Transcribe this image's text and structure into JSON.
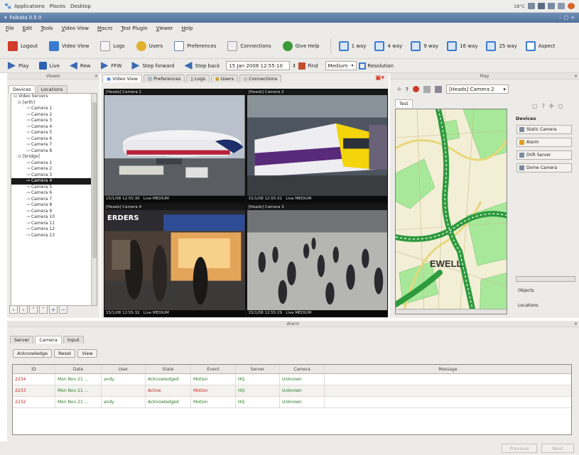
{
  "desktop": {
    "menu": [
      "Applications",
      "Places",
      "Desktop"
    ],
    "clock": "18°C"
  },
  "window": {
    "title": "Falkata 0.5.0",
    "controls": [
      "–",
      "□",
      "×"
    ]
  },
  "menubar": [
    "File",
    "Edit",
    "Tools",
    "Video View",
    "Macro",
    "Test Plugin",
    "Viewer",
    "Help"
  ],
  "toolbar1": [
    {
      "label": "Logout",
      "icon": "logout-icon",
      "color": "#d23a2a"
    },
    {
      "label": "Video View",
      "icon": "video-view-icon",
      "color": "#3b7bd0"
    },
    {
      "label": "Logs",
      "icon": "logs-icon",
      "color": "#e8e8e8"
    },
    {
      "label": "Users",
      "icon": "users-icon",
      "color": "#e0b030"
    },
    {
      "label": "Preferences",
      "icon": "preferences-icon",
      "color": "#8aa0c8"
    },
    {
      "label": "Connections",
      "icon": "connections-icon",
      "color": "#d8d8d8"
    },
    {
      "label": "Give Help",
      "icon": "help-icon",
      "color": "#3a9a3a"
    }
  ],
  "layout_buttons": [
    {
      "label": "1 way",
      "icon": "one-way-layout-icon"
    },
    {
      "label": "4 way",
      "icon": "four-way-layout-icon"
    },
    {
      "label": "9 way",
      "icon": "nine-way-layout-icon"
    },
    {
      "label": "16 way",
      "icon": "sixteen-way-layout-icon"
    },
    {
      "label": "25 way",
      "icon": "twenty-five-way-layout-icon"
    },
    {
      "label": "Aspect",
      "icon": "aspect-icon"
    }
  ],
  "toolbar2": {
    "buttons": [
      {
        "label": "Play",
        "icon": "play-icon"
      },
      {
        "label": "Live",
        "icon": "live-icon"
      },
      {
        "label": "Rew",
        "icon": "rewind-icon"
      },
      {
        "label": "FFW",
        "icon": "fast-forward-icon"
      },
      {
        "label": "Step forward",
        "icon": "step-forward-icon"
      },
      {
        "label": "Step back",
        "icon": "step-back-icon"
      }
    ],
    "datetime_value": "15 Jan 2008 12:55:10",
    "find_label": "Find",
    "resolution_value": "Medium",
    "resolution_label": "Resolution"
  },
  "viewer": {
    "header": "Viewer",
    "tabs": [
      "Devices",
      "Locations"
    ],
    "tree": [
      {
        "label": "Video Servers",
        "indent": 0,
        "icon": "folder-icon",
        "selected": false
      },
      {
        "label": "[erth]",
        "indent": 1,
        "icon": "server-icon",
        "selected": false
      },
      {
        "label": "Camera 1",
        "indent": 3,
        "icon": "camera-icon",
        "selected": false
      },
      {
        "label": "Camera 2",
        "indent": 3,
        "icon": "camera-icon",
        "selected": false
      },
      {
        "label": "Camera 3",
        "indent": 3,
        "icon": "camera-icon",
        "selected": false
      },
      {
        "label": "Camera 4",
        "indent": 3,
        "icon": "camera-icon",
        "selected": false
      },
      {
        "label": "Camera 5",
        "indent": 3,
        "icon": "camera-icon",
        "selected": false
      },
      {
        "label": "Camera 6",
        "indent": 3,
        "icon": "camera-icon",
        "selected": false
      },
      {
        "label": "Camera 7",
        "indent": 3,
        "icon": "camera-icon",
        "selected": false
      },
      {
        "label": "Camera 8",
        "indent": 3,
        "icon": "camera-icon",
        "selected": false
      },
      {
        "label": "[bridge]",
        "indent": 1,
        "icon": "server-icon",
        "selected": false
      },
      {
        "label": "Camera 1",
        "indent": 3,
        "icon": "camera-icon",
        "selected": false
      },
      {
        "label": "Camera 2",
        "indent": 3,
        "icon": "camera-icon",
        "selected": false
      },
      {
        "label": "Camera 3",
        "indent": 3,
        "icon": "camera-icon",
        "selected": false
      },
      {
        "label": "Camera 4",
        "indent": 3,
        "icon": "camera-icon",
        "selected": true
      },
      {
        "label": "Camera 5",
        "indent": 3,
        "icon": "camera-icon",
        "selected": false
      },
      {
        "label": "Camera 6",
        "indent": 3,
        "icon": "camera-icon",
        "selected": false
      },
      {
        "label": "Camera 7",
        "indent": 3,
        "icon": "camera-icon",
        "selected": false
      },
      {
        "label": "Camera 8",
        "indent": 3,
        "icon": "camera-icon",
        "selected": false
      },
      {
        "label": "Camera 9",
        "indent": 3,
        "icon": "camera-icon",
        "selected": false
      },
      {
        "label": "Camera 10",
        "indent": 3,
        "icon": "camera-icon",
        "selected": false
      },
      {
        "label": "Camera 11",
        "indent": 3,
        "icon": "camera-icon",
        "selected": false
      },
      {
        "label": "Camera 12",
        "indent": 3,
        "icon": "camera-icon",
        "selected": false
      },
      {
        "label": "Camera 13",
        "indent": 3,
        "icon": "camera-icon",
        "selected": false
      }
    ],
    "nav": [
      {
        "glyph": "‹",
        "icon": "nav-left-icon"
      },
      {
        "glyph": "›",
        "icon": "nav-right-icon"
      },
      {
        "glyph": "˄",
        "icon": "nav-up-icon"
      },
      {
        "glyph": "˅",
        "icon": "nav-down-icon"
      },
      {
        "glyph": "+",
        "icon": "zoom-in-icon"
      },
      {
        "glyph": "−",
        "icon": "zoom-out-icon"
      }
    ]
  },
  "main_tabs": [
    "Video View",
    "Preferences",
    "Logs",
    "Users",
    "Connections"
  ],
  "cameras": [
    {
      "title": "[Heads] Camera 1",
      "time": "15/1/08 12:55:30",
      "mode": "Live MEDIUM",
      "scene": "plane"
    },
    {
      "title": "[Heads] Camera 2",
      "time": "15/1/08 12:55:31",
      "mode": "Live MEDIUM",
      "scene": "train"
    },
    {
      "title": "[Heads] Camera 4",
      "time": "15/1/08 12:55:32",
      "mode": "Live MEDIUM",
      "scene": "shop"
    },
    {
      "title": "[Heads] Camera 3",
      "time": "15/1/08 12:55:29",
      "mode": "Live MEDIUM",
      "scene": "crowd"
    }
  ],
  "map": {
    "header": "Map",
    "selected_camera": "[Heads] Camera 2",
    "tab": "Test",
    "place_label": "EWELL",
    "devices_header": "Devices",
    "devices": [
      {
        "label": "Static Camera",
        "icon": "static-camera-icon"
      },
      {
        "label": "Alarm",
        "icon": "alarm-icon"
      },
      {
        "label": "DVR Server",
        "icon": "dvr-server-icon"
      },
      {
        "label": "Dome Camera",
        "icon": "dome-camera-icon"
      }
    ],
    "objects_label": "Objects",
    "locations_label": "Locations"
  },
  "alarm": {
    "header": "Alarm",
    "tabs": [
      "Server",
      "Camera",
      "Input"
    ],
    "active_tab": "Camera",
    "buttons": [
      "Acknowledge",
      "Reset",
      "View"
    ],
    "columns": [
      "ID",
      "Date",
      "User",
      "State",
      "Event",
      "Server",
      "Camera",
      "Message"
    ],
    "rows": [
      {
        "id": "2234",
        "date": "Mon Nov 21 ...",
        "user": "andy",
        "state": "Acknowledged",
        "event": "Motion",
        "server": "HQ",
        "camera": "Unknown",
        "message": "",
        "status_color": "#c02020"
      },
      {
        "id": "2233",
        "date": "Mon Nov 21 ...",
        "user": "",
        "state": "Active",
        "event": "Motion",
        "server": "HQ",
        "camera": "Unknown",
        "message": "",
        "status_color": "#c02020"
      },
      {
        "id": "2232",
        "date": "Mon Nov 21 ...",
        "user": "andy",
        "state": "Acknowledged",
        "event": "Motion",
        "server": "HQ",
        "camera": "Unknown",
        "message": "",
        "status_color": "#c02020"
      }
    ]
  },
  "footer": {
    "previous_label": "Previous",
    "next_label": "Next"
  },
  "colors": {
    "titlebar": "#5f80ab",
    "selection": "#1a1a1a",
    "map_road": "#2e9a3e",
    "map_green": "#a8e89a"
  }
}
